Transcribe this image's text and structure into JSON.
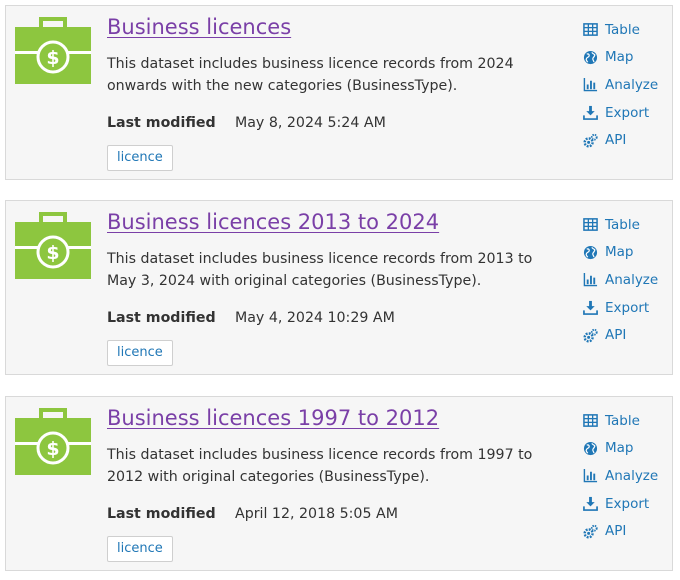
{
  "brand_color": "#8dc63f",
  "link_color": "#2077b6",
  "title_color": "#7a3fa7",
  "datasets": [
    {
      "title": "Business licences",
      "description": "This dataset includes business licence records from 2024 onwards with the new categories (BusinessType).",
      "last_modified_label": "Last modified",
      "last_modified": "May 8, 2024 5:24 AM",
      "tag": "licence",
      "icon": "briefcase-dollar-icon",
      "actions": [
        {
          "label": "Table",
          "icon": "table-icon"
        },
        {
          "label": "Map",
          "icon": "globe-icon"
        },
        {
          "label": "Analyze",
          "icon": "bar-chart-icon"
        },
        {
          "label": "Export",
          "icon": "download-icon"
        },
        {
          "label": "API",
          "icon": "gears-icon"
        }
      ]
    },
    {
      "title": "Business licences 2013 to 2024",
      "description": "This dataset includes business licence records from 2013 to May 3, 2024 with original categories (BusinessType).",
      "last_modified_label": "Last modified",
      "last_modified": "May 4, 2024 10:29 AM",
      "tag": "licence",
      "icon": "briefcase-dollar-icon",
      "actions": [
        {
          "label": "Table",
          "icon": "table-icon"
        },
        {
          "label": "Map",
          "icon": "globe-icon"
        },
        {
          "label": "Analyze",
          "icon": "bar-chart-icon"
        },
        {
          "label": "Export",
          "icon": "download-icon"
        },
        {
          "label": "API",
          "icon": "gears-icon"
        }
      ]
    },
    {
      "title": "Business licences 1997 to 2012",
      "description": "This dataset includes business licence records from 1997 to 2012 with original categories (BusinessType).",
      "last_modified_label": "Last modified",
      "last_modified": "April 12, 2018 5:05 AM",
      "tag": "licence",
      "icon": "briefcase-dollar-icon",
      "actions": [
        {
          "label": "Table",
          "icon": "table-icon"
        },
        {
          "label": "Map",
          "icon": "globe-icon"
        },
        {
          "label": "Analyze",
          "icon": "bar-chart-icon"
        },
        {
          "label": "Export",
          "icon": "download-icon"
        },
        {
          "label": "API",
          "icon": "gears-icon"
        }
      ]
    }
  ]
}
